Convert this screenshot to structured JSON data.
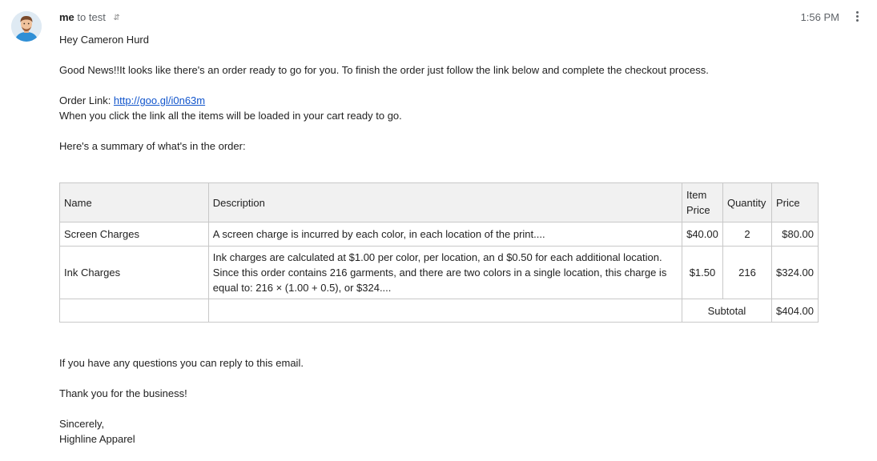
{
  "header": {
    "sender": "me",
    "recipient_prefix": "to",
    "recipient": "test",
    "details_toggle": "⌃⌄",
    "time": "1:56 PM"
  },
  "body": {
    "greeting": "Hey Cameron Hurd",
    "intro": "Good News!!It looks like there's an order ready to go for you. To finish the order just follow the link below and complete the checkout process.",
    "order_link_label": "Order Link: ",
    "order_link_url": "http://goo.gl/i0n63m",
    "cart_note": "When you click the link all the items will be loaded in your cart ready to go.",
    "summary_intro": "Here's a summary of what's in the order:"
  },
  "table": {
    "headers": {
      "name": "Name",
      "description": "Description",
      "item_price": "Item Price",
      "quantity": "Quantity",
      "price": "Price"
    },
    "rows": [
      {
        "name": "Screen Charges",
        "description": "A screen charge is incurred by each color, in each location of the print....",
        "item_price": "$40.00",
        "quantity": "2",
        "price": "$80.00"
      },
      {
        "name": "Ink Charges",
        "description": "Ink charges are calculated at $1.00 per color, per location, an d $0.50 for each additional location. Since this order contains 216 garments, and there are two colors in a single location, this charge is equal to: 216 × (1.00 + 0.5), or $324....",
        "item_price": "$1.50",
        "quantity": "216",
        "price": "$324.00"
      }
    ],
    "subtotal_label": "Subtotal",
    "subtotal_value": "$404.00"
  },
  "footer": {
    "questions": "If you have any questions you can reply to this email.",
    "thanks": "Thank you for the business!",
    "closing": "Sincerely,",
    "company": "Highline Apparel"
  },
  "colors": {
    "link": "#1155cc",
    "table_header_bg": "#f1f1f1",
    "border": "#c8c8c8",
    "muted_text": "#5f6368"
  }
}
